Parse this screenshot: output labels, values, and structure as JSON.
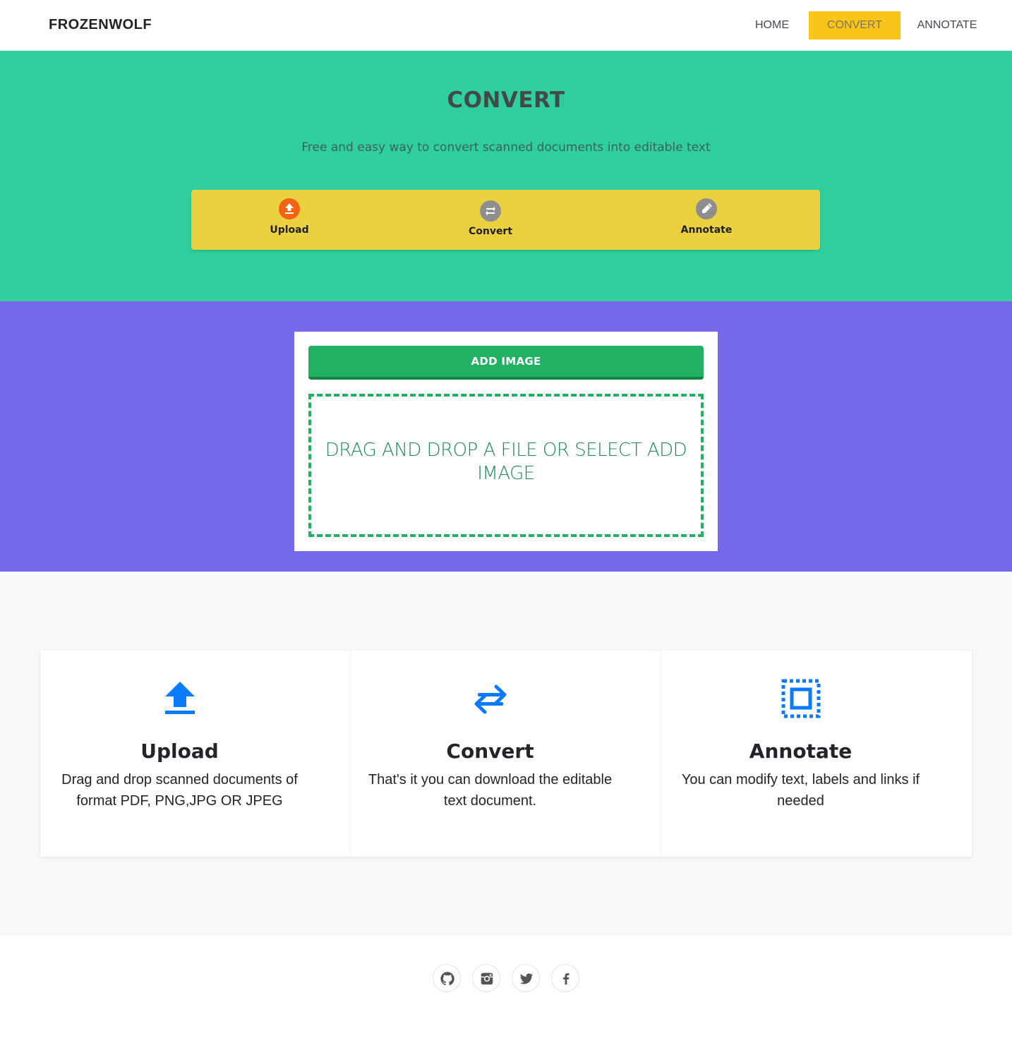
{
  "navbar": {
    "brand": "FROZENWOLF",
    "links": [
      {
        "label": "HOME",
        "active": false
      },
      {
        "label": "CONVERT",
        "active": true
      },
      {
        "label": "ANNOTATE",
        "active": false
      }
    ]
  },
  "hero": {
    "title": "CONVERT",
    "subtitle": "Free and easy way to convert scanned documents into editable text",
    "steps": [
      {
        "label": "Upload",
        "icon": "upload-icon",
        "color": "#f26414"
      },
      {
        "label": "Convert",
        "icon": "convert-arrows-icon",
        "color": "#8e8e8e"
      },
      {
        "label": "Annotate",
        "icon": "pencil-icon",
        "color": "#8e8e8e"
      }
    ]
  },
  "uploader": {
    "button_label": "ADD IMAGE",
    "drop_text": "DRAG AND DROP A FILE OR SELECT ADD IMAGE"
  },
  "features": [
    {
      "title": "Upload",
      "text": "Drag and drop scanned documents of format PDF, PNG,JPG OR JPEG",
      "icon": "upload-icon"
    },
    {
      "title": "Convert",
      "text": "That's it you can download the editable text document.",
      "icon": "swap-arrows-icon"
    },
    {
      "title": "Annotate",
      "text": "You can modify text, labels and links if needed",
      "icon": "select-frame-icon"
    }
  ],
  "footer": {
    "social": [
      "github-icon",
      "instagram-icon",
      "twitter-icon",
      "facebook-icon"
    ]
  },
  "colors": {
    "hero_bg": "#2ecf9d",
    "steps_bg": "#ebd13f",
    "upload_bg": "#7668ea",
    "accent_green": "#22b063",
    "nav_active": "#f9c519",
    "feature_icon": "#0a7bff"
  }
}
